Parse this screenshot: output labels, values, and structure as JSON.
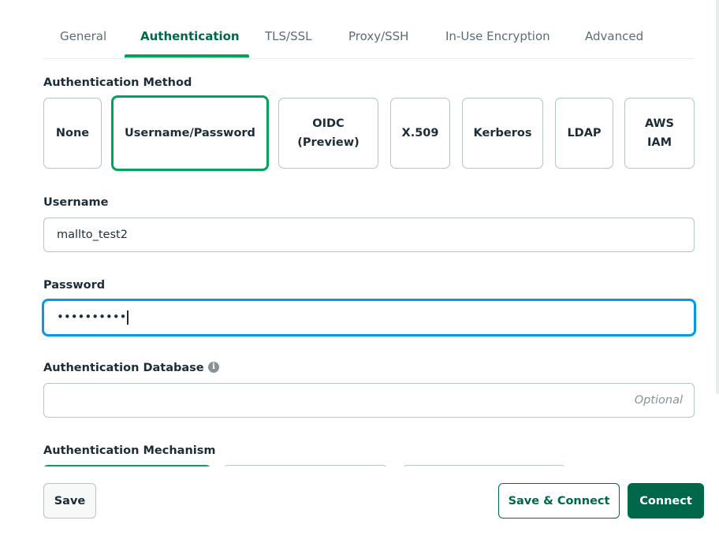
{
  "tabs": [
    {
      "label": "General",
      "active": false
    },
    {
      "label": "Authentication",
      "active": true
    },
    {
      "label": "TLS/SSL",
      "active": false
    },
    {
      "label": "Proxy/SSH",
      "active": false
    },
    {
      "label": "In-Use Encryption",
      "active": false
    },
    {
      "label": "Advanced",
      "active": false
    }
  ],
  "auth_method": {
    "label": "Authentication Method",
    "options": [
      {
        "label": "None",
        "selected": false
      },
      {
        "label": "Username/Password",
        "selected": true
      },
      {
        "label": "OIDC\n(Preview)",
        "selected": false
      },
      {
        "label": "X.509",
        "selected": false
      },
      {
        "label": "Kerberos",
        "selected": false
      },
      {
        "label": "LDAP",
        "selected": false
      },
      {
        "label": "AWS\nIAM",
        "selected": false
      }
    ]
  },
  "username": {
    "label": "Username",
    "value": "mallto_test2"
  },
  "password": {
    "label": "Password",
    "value": "••••••••••"
  },
  "auth_database": {
    "label": "Authentication Database",
    "value": "",
    "placeholder": "Optional",
    "icon": "info-icon"
  },
  "auth_mechanism": {
    "label": "Authentication Mechanism"
  },
  "footer": {
    "save_label": "Save",
    "save_connect_label": "Save & Connect",
    "connect_label": "Connect"
  },
  "colors": {
    "accent_green": "#00a35c",
    "dark_green": "#00684a",
    "focus_blue": "#0498ec"
  }
}
